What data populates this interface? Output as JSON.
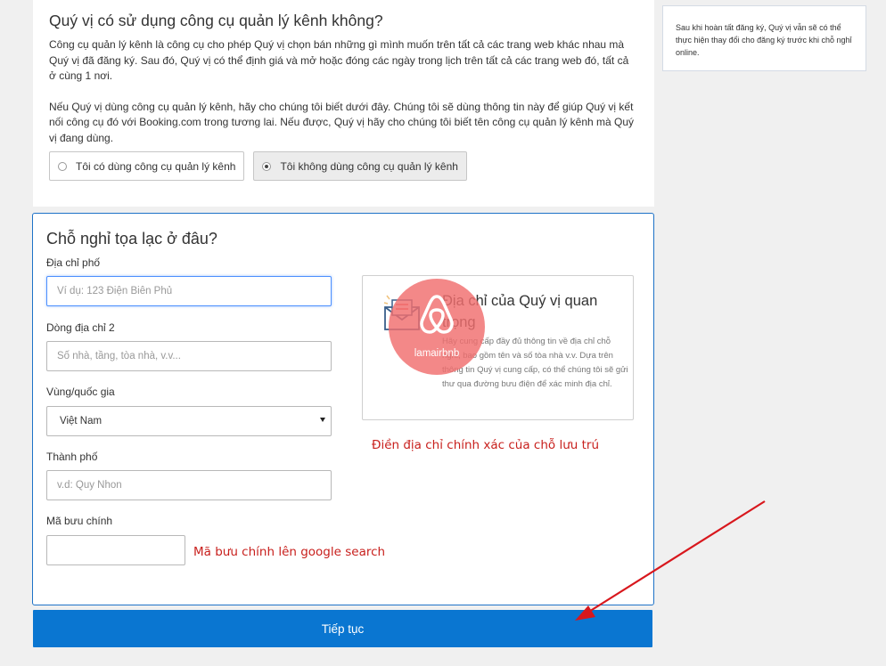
{
  "channel_manager": {
    "title": "Quý vị có sử dụng công cụ quản lý kênh không?",
    "para1": "Công cụ quản lý kênh là công cụ cho phép Quý vị chọn bán những gì mình muốn trên tất cả các trang web khác nhau mà Quý vị đã đăng ký. Sau đó, Quý vị có thể định giá và mở hoặc đóng các ngày trong lịch trên tất cả các trang web đó, tất cả ở cùng 1 nơi.",
    "para2": "Nếu Quý vị dùng công cụ quản lý kênh, hãy cho chúng tôi biết dưới đây. Chúng tôi sẽ dùng thông tin này để giúp Quý vị kết nối công cụ đó với Booking.com trong tương lai. Nếu được, Quý vị hãy cho chúng tôi biết tên công cụ quản lý kênh mà Quý vị đang dùng.",
    "option_yes": "Tôi có dùng công cụ quản lý kênh",
    "option_no": "Tôi không dùng công cụ quản lý kênh"
  },
  "side_note": "Sau khi hoàn tất đăng ký, Quý vị vẫn sẽ có thể thực hiện thay đổi cho đăng ký trước khi chỗ nghỉ online.",
  "location": {
    "title": "Chỗ nghỉ tọa lạc ở đâu?",
    "street_label": "Địa chỉ phố",
    "street_placeholder": "Ví dụ: 123 Điện Biên Phủ",
    "line2_label": "Dòng địa chỉ 2",
    "line2_placeholder": "Số nhà, tầng, tòa nhà, v.v...",
    "country_label": "Vùng/quốc gia",
    "country_value": "Việt Nam",
    "city_label": "Thành phố",
    "city_placeholder": "v.d: Quy Nhon",
    "zip_label": "Mã bưu chính",
    "zip_placeholder": ""
  },
  "info_box": {
    "title": "Địa chỉ của Quý vị quan trọng",
    "text": "Hãy cung cấp đầy đủ thông tin về địa chỉ chỗ nghỉ, bao gồm tên và số tòa nhà v.v. Dựa trên thông tin Quý vị cung cấp, có thể chúng tôi sẽ gửi thư qua đường bưu điện để xác minh địa chỉ."
  },
  "watermark": {
    "text": "lamairbnb"
  },
  "annotations": {
    "address_note": "Điền địa chỉ chính xác của chỗ lưu trú",
    "zip_note": "Mã bưu chính lên google search"
  },
  "continue_label": "Tiếp tục",
  "colors": {
    "primary": "#0a76d1",
    "annotation": "#c8201d",
    "watermark": "#f06e6e"
  }
}
